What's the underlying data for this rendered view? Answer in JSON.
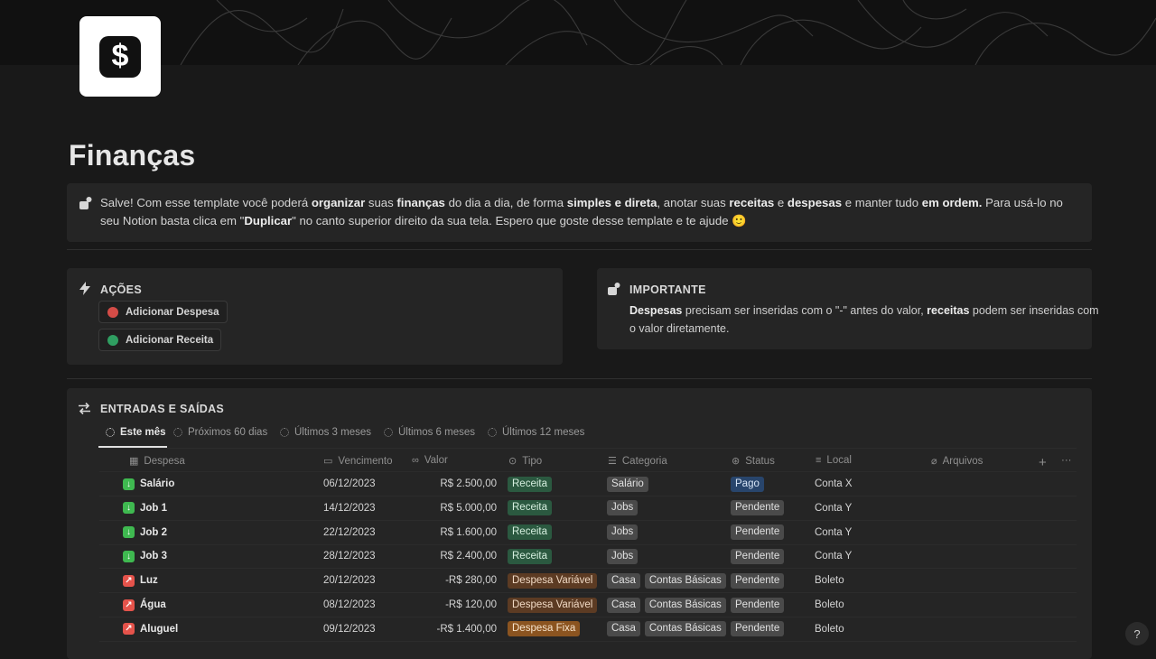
{
  "page": {
    "icon": "dollar-icon",
    "icon_glyph": "$",
    "title": "Finanças"
  },
  "intro": {
    "icon": "hand-icon",
    "parts": [
      {
        "t": "Salve! Com esse template você poderá ",
        "b": false
      },
      {
        "t": "organizar",
        "b": true
      },
      {
        "t": " suas ",
        "b": false
      },
      {
        "t": "finanças",
        "b": true
      },
      {
        "t": " do dia a dia, de forma ",
        "b": false
      },
      {
        "t": "simples e direta",
        "b": true
      },
      {
        "t": ", anotar suas ",
        "b": false
      },
      {
        "t": "receitas",
        "b": true
      },
      {
        "t": " e ",
        "b": false
      },
      {
        "t": "despesas",
        "b": true
      },
      {
        "t": " e manter tudo ",
        "b": false
      },
      {
        "t": "em ordem.",
        "b": true
      },
      {
        "t": " Para usá-lo no seu Notion basta clica em \"",
        "b": false
      },
      {
        "t": "Duplicar",
        "b": true
      },
      {
        "t": "\" no canto superior direito da sua tela. Espero que goste desse template e te ajude 🙂",
        "b": false
      }
    ]
  },
  "actions": {
    "title": "AÇÕES",
    "buttons": [
      {
        "label": "Adicionar Despesa",
        "color": "#d44c47"
      },
      {
        "label": "Adicionar Receita",
        "color": "#2f9e61"
      }
    ]
  },
  "important": {
    "title": "IMPORTANTE",
    "parts": [
      {
        "t": "Despesas",
        "b": true
      },
      {
        "t": " precisam ser inseridas com o \"-\" antes do valor, ",
        "b": false
      },
      {
        "t": "receitas",
        "b": true
      },
      {
        "t": " podem ser inseridas com o valor diretamente.",
        "b": false
      }
    ]
  },
  "table": {
    "title": "ENTRADAS E SAÍDAS",
    "tabs": [
      "Este mês",
      "Próximos 60 dias",
      "Últimos 3 meses",
      "Últimos 6 meses",
      "Últimos 12 meses"
    ],
    "columns": [
      "Despesa",
      "Vencimento",
      "Valor",
      "Tipo",
      "Categoria",
      "Status",
      "Local",
      "Arquivos"
    ],
    "add_glyph": "+",
    "more_glyph": "···",
    "rows": [
      {
        "name": "Salário",
        "kind": "in",
        "date": "06/12/2023",
        "value": "R$ 2.500,00",
        "tipo": "Receita",
        "categoria": [
          "Salário"
        ],
        "status": "Pago",
        "local": "Conta X"
      },
      {
        "name": "Job 1",
        "kind": "in",
        "date": "14/12/2023",
        "value": "R$ 5.000,00",
        "tipo": "Receita",
        "categoria": [
          "Jobs"
        ],
        "status": "Pendente",
        "local": "Conta Y"
      },
      {
        "name": "Job 2",
        "kind": "in",
        "date": "22/12/2023",
        "value": "R$ 1.600,00",
        "tipo": "Receita",
        "categoria": [
          "Jobs"
        ],
        "status": "Pendente",
        "local": "Conta Y"
      },
      {
        "name": "Job 3",
        "kind": "in",
        "date": "28/12/2023",
        "value": "R$ 2.400,00",
        "tipo": "Receita",
        "categoria": [
          "Jobs"
        ],
        "status": "Pendente",
        "local": "Conta Y"
      },
      {
        "name": "Luz",
        "kind": "out",
        "date": "20/12/2023",
        "value": "-R$ 280,00",
        "tipo": "Despesa Variável",
        "categoria": [
          "Casa",
          "Contas Básicas"
        ],
        "status": "Pendente",
        "local": "Boleto"
      },
      {
        "name": "Água",
        "kind": "out",
        "date": "08/12/2023",
        "value": "-R$ 120,00",
        "tipo": "Despesa Variável",
        "categoria": [
          "Casa",
          "Contas Básicas"
        ],
        "status": "Pendente",
        "local": "Boleto"
      },
      {
        "name": "Aluguel",
        "kind": "out",
        "date": "09/12/2023",
        "value": "-R$ 1.400,00",
        "tipo": "Despesa Fixa",
        "categoria": [
          "Casa",
          "Contas Básicas"
        ],
        "status": "Pendente",
        "local": "Boleto"
      }
    ]
  },
  "help_label": "?"
}
